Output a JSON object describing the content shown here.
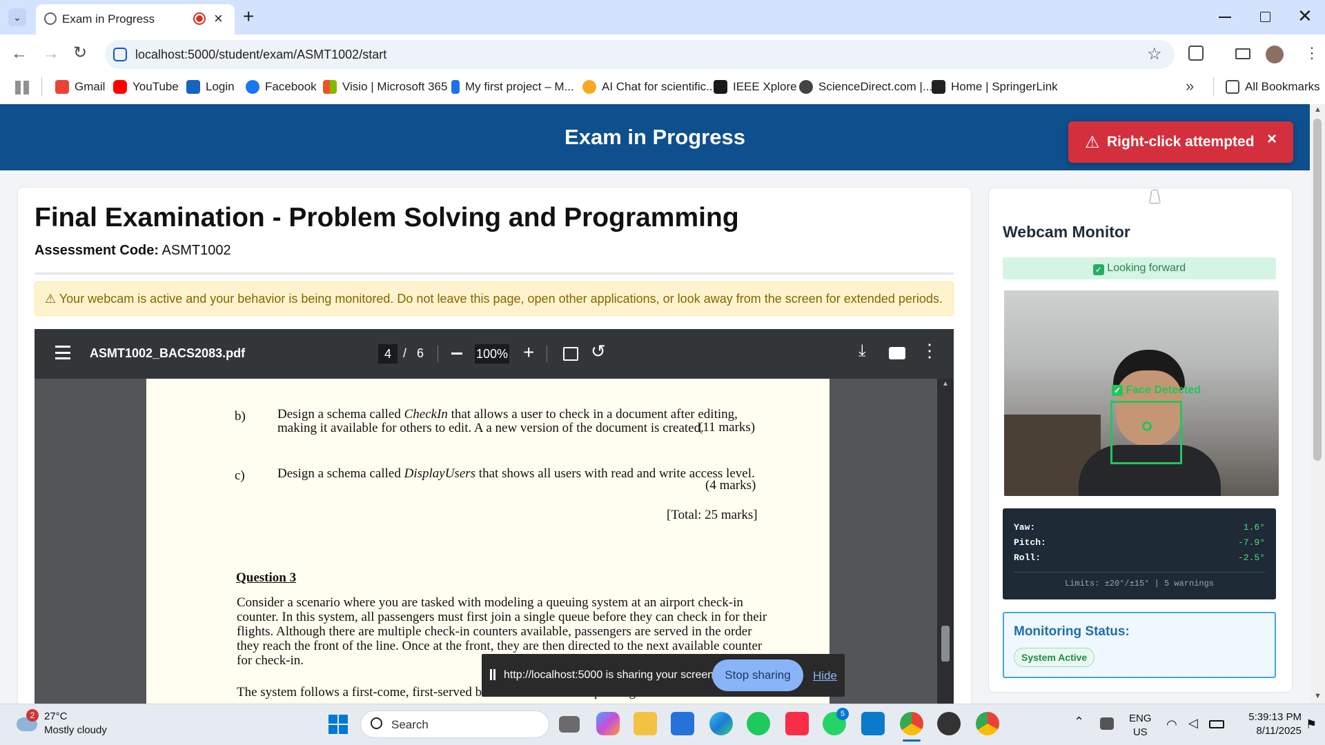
{
  "browser": {
    "tab_title": "Exam in Progress",
    "url": "localhost:5000/student/exam/ASMT1002/start",
    "bookmarks": [
      "Gmail",
      "YouTube",
      "Login",
      "Facebook",
      "Visio | Microsoft 365",
      "My first project – M...",
      "AI Chat for scientific...",
      "IEEE Xplore",
      "ScienceDirect.com |...",
      "Home | SpringerLink"
    ],
    "all_bookmarks": "All Bookmarks"
  },
  "header": {
    "title": "Exam in Progress"
  },
  "alert": {
    "icon": "⚠",
    "text": "Right-click attempted",
    "close": "×",
    "color": "#d32f3c"
  },
  "exam": {
    "title": "Final Examination - Problem Solving and Programming",
    "code_label": "Assessment Code:",
    "code_value": "ASMT1002",
    "warning": "⚠ Your webcam is active and your behavior is being monitored. Do not leave this page, open other applications, or look away from the screen for extended periods."
  },
  "pdf": {
    "filename": "ASMT1002_BACS2083.pdf",
    "page_current": "4",
    "page_sep": "/",
    "page_total": "6",
    "zoom": "100%",
    "lines": {
      "b_label": "b)",
      "b1a": "Design a schema called ",
      "b1b": "CheckIn",
      "b1c": " that allows a user to check in a document after editing,",
      "b2": "making it available for others to edit. A a new version of the document is created.",
      "b_marks": "(11 marks)",
      "c_label": "c)",
      "c1a": "Design a schema called ",
      "c1b": "DisplayUsers",
      "c1c": " that shows all users with read and write access level.",
      "c_marks": "(4 marks)",
      "total": "[Total: 25 marks]",
      "q3": "Question 3",
      "p1": "Consider a scenario where you are tasked with modeling a queuing system at an airport check-in",
      "p2": "counter. In this system, all passengers must first join a single queue before they can check in for their",
      "p3": "flights. Although there are multiple check-in counters available, passengers are served in the order",
      "p4": "they reach the front of the line. Once at the front, they are then directed to the next available counter",
      "p5": "for check-in.",
      "p6": "The system follows a first-come, first-served basis. This means that passengers are attended in the"
    }
  },
  "share": {
    "text": "http://localhost:5000 is sharing your screen.",
    "stop": "Stop sharing",
    "hide": "Hide"
  },
  "webcam": {
    "title": "Webcam Monitor",
    "gaze_status": "Looking forward",
    "face_label": "Face Detected",
    "yaw_label": "Yaw:",
    "yaw": "1.6°",
    "pitch_label": "Pitch:",
    "pitch": "-7.9°",
    "roll_label": "Roll:",
    "roll": "-2.5°",
    "limits": "Limits: ±20°/±15° | 5 warnings"
  },
  "monitoring": {
    "title": "Monitoring Status:",
    "badge": "System Active"
  },
  "taskbar": {
    "weather_badge": "2",
    "temp": "27°C",
    "weather": "Mostly cloudy",
    "search": "Search",
    "vscode_badge": "5",
    "lang1": "ENG",
    "lang2": "US",
    "time": "5:39:13 PM",
    "date": "8/11/2025"
  }
}
